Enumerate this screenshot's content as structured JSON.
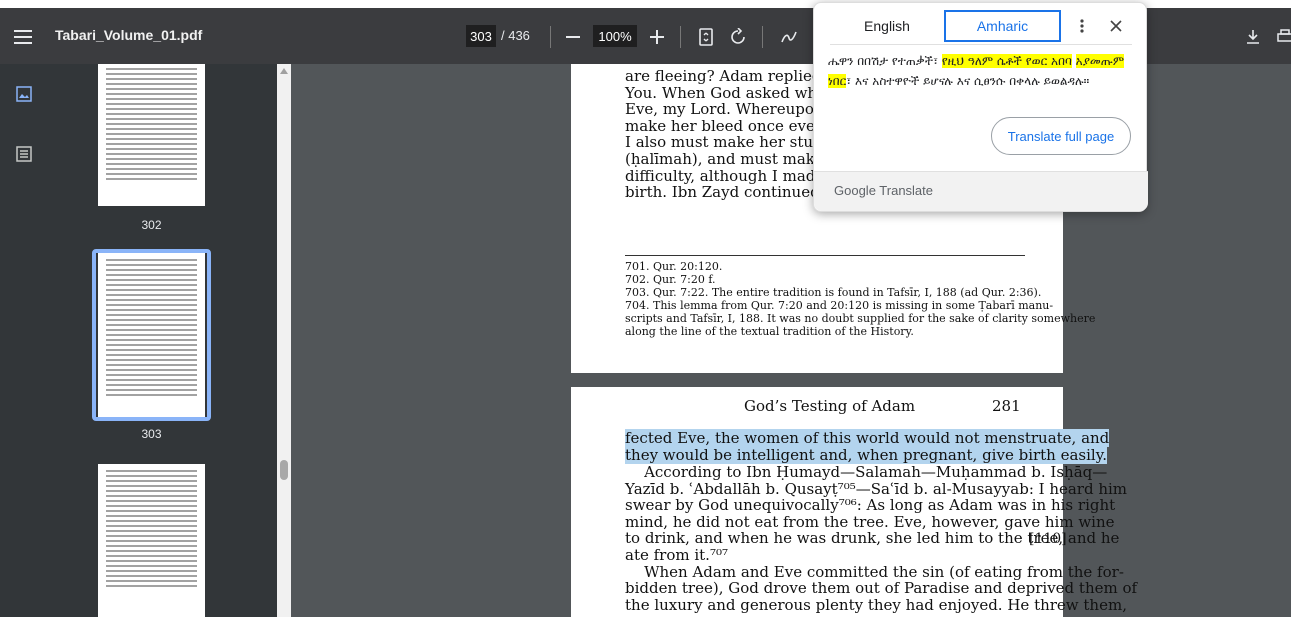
{
  "toolbar": {
    "filename": "Tabari_Volume_01.pdf",
    "current_page": "303",
    "total_pages": "/ 436",
    "zoom": "100%"
  },
  "thumbnails": [
    {
      "label": "302"
    },
    {
      "label": "303",
      "selected": true
    },
    {
      "label": ""
    }
  ],
  "page1": {
    "lines": [
      "are fleeing? Adam replied: No,",
      "You. When God asked what h",
      "Eve, my Lord. Whereupon Go",
      "make her bleed once every mo",
      "I also must make her stupid, ",
      "(ḥalīmah), and must make he",
      "difficulty, although I made it e",
      "birth. Ibn Zayd continued: We"
    ],
    "footnotes": [
      "701. Qur. 20:120.",
      "702. Qur. 7:20 f.",
      "703. Qur. 7:22. The entire tradition is found in Tafsīr, I, 188 (ad Qur. 2:36).",
      "704. This lemma from Qur. 7:20 and 20:120 is missing in some Ṭabarī manu-",
      "scripts and Tafsīr, I, 188. It was no doubt supplied for the sake of clarity somewhere",
      "along the line of the textual tradition of the History."
    ]
  },
  "page2": {
    "running_title": "God’s Testing of Adam",
    "page_number": "281",
    "highlighted": [
      "fected Eve, the women of this world would not menstruate, and",
      "they would be intelligent and, when pregnant, give birth easily."
    ],
    "lines": [
      "    According to Ibn Ḥumayd—Salamah—Muḥammad b. Isḥāq—",
      "Yazīd b. ʿAbdallāh b. Qusayṭ⁷⁰⁵—Saʿīd b. al-Musayyab: I heard him",
      "swear by God unequivocally⁷⁰⁶: As long as Adam was in his right",
      "mind, he did not eat from the tree. Eve, however, gave him wine",
      "to drink, and when he was drunk, she led him to the tree, and he",
      "ate from it.⁷⁰⁷",
      "    When Adam and Eve committed the sin (of eating from the for-",
      "bidden tree), God drove them out of Paradise and deprived them of",
      "the luxury and generous plenty they had enjoyed. He threw them,"
    ],
    "margin_number": "[110]"
  },
  "translate_popup": {
    "tab_english": "English",
    "tab_amharic": "Amharic",
    "text_plain": "ሔዋን በበሽታ የተጠቃች፣ ",
    "text_highlight1": "የዚህ ዓለም ሴቶች የወር አበባ",
    "text_highlight2": "አያመጡም ነበር",
    "text_rest": "፣ እና አስተዋዮች ይሆናሉ እና ሲፀንሱ በቀላሉ ይወልዳሉ።",
    "translate_full_page": "Translate full page",
    "brand": "Google Translate"
  }
}
